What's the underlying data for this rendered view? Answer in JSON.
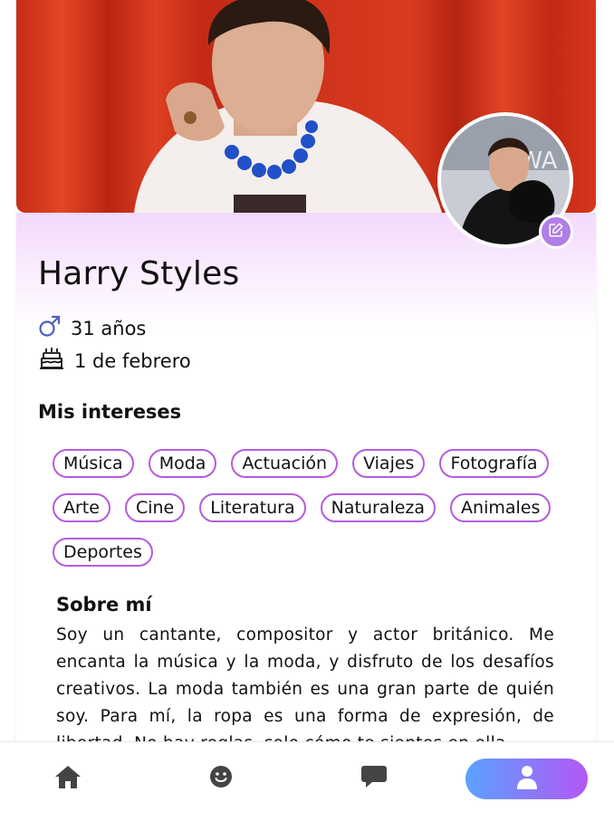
{
  "profile": {
    "name": "Harry Styles",
    "age": "31 años",
    "birthday": "1 de febrero"
  },
  "interests": {
    "title": "Mis intereses",
    "tags": [
      "Música",
      "Moda",
      "Actuación",
      "Viajes",
      "Fotografía",
      "Arte",
      "Cine",
      "Literatura",
      "Naturaleza",
      "Animales",
      "Deportes"
    ]
  },
  "about": {
    "title": "Sobre mí",
    "text": "Soy un cantante, compositor y actor británico. Me encanta la música y la moda, y disfruto de los desafíos creativos. La moda también es una gran parte de quién soy. Para mí, la ropa es una forma de expresión, de libertad. No hay reglas, solo cómo te sientes en ella."
  },
  "nav": {
    "items": [
      "home-icon",
      "smile-icon",
      "chat-icon",
      "user-icon"
    ],
    "active": "user-icon"
  },
  "colors": {
    "accent": "#b45cdc",
    "edit_button": "#b07ee6",
    "nav_gradient_start": "#5aa2ff",
    "nav_gradient_end": "#b357f5",
    "cover_background": "#d8351e"
  }
}
